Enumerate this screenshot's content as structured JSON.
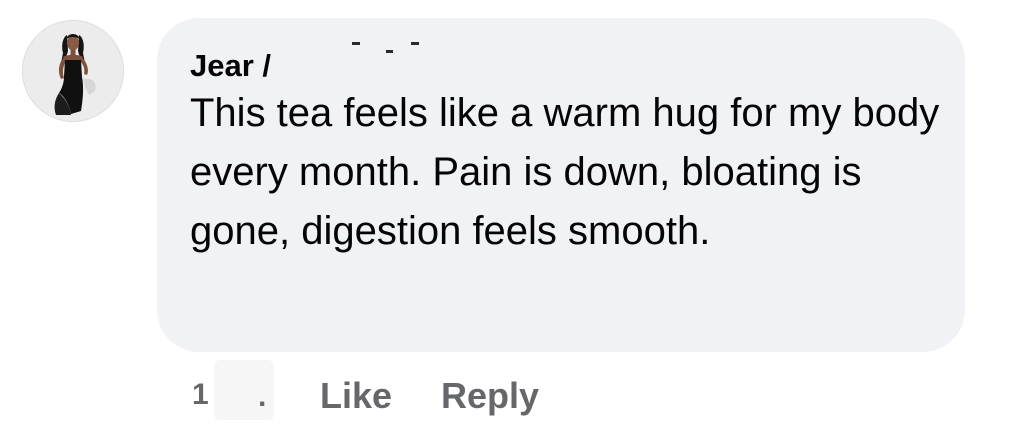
{
  "comment": {
    "author": "Jear /",
    "text": "This tea feels like a warm hug for my body every month. Pain is down, bloating is gone, digestion feels smooth.",
    "timestamp_digit": "1",
    "timestamp_dot": ".",
    "actions": {
      "like_label": "Like",
      "reply_label": "Reply"
    }
  },
  "colors": {
    "bubble_bg": "#f0f2f5",
    "text": "#050505",
    "secondary_text": "#65676b"
  }
}
